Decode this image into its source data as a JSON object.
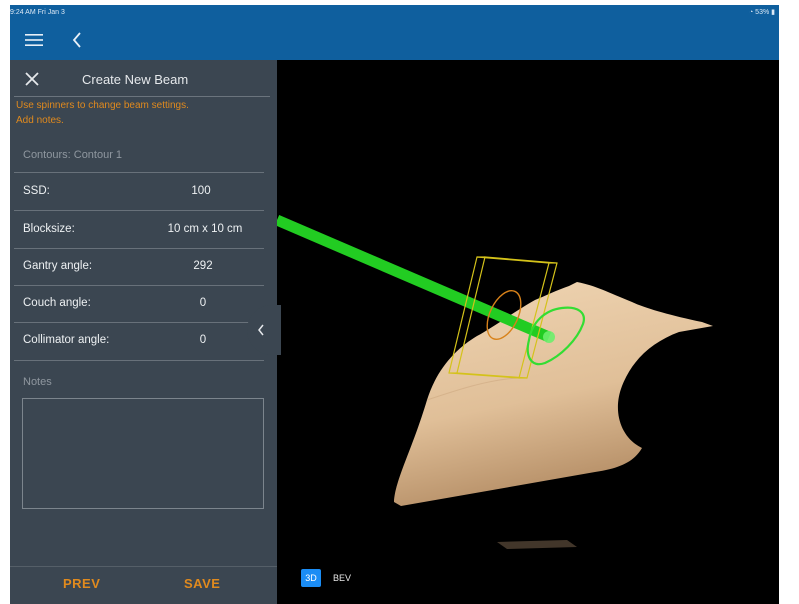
{
  "status_bar": {
    "time": "9:24 AM  Fri Jan 3",
    "battery": "53%"
  },
  "navbar": {
    "menu_icon": "hamburger-icon",
    "back_icon": "chevron-left-icon",
    "color": "#0f5f9e"
  },
  "panel": {
    "title": "Create New Beam",
    "instructions_line1": "Use spinners to change beam settings.",
    "instructions_line2": "Add notes.",
    "contours": "Contours: Contour 1",
    "fields": [
      {
        "label": "SSD:",
        "value": "100"
      },
      {
        "label": "Blocksize:",
        "value": "10 cm x 10 cm"
      },
      {
        "label": "Gantry angle:",
        "value": "292"
      },
      {
        "label": "Couch angle:",
        "value": "0"
      },
      {
        "label": "Collimator angle:",
        "value": "0"
      }
    ],
    "notes_label": "Notes",
    "notes_value": "",
    "prev_label": "PREV",
    "save_label": "SAVE",
    "accent_color": "#e08a1e",
    "background": "#3b4651"
  },
  "viewport": {
    "mode_3d_label": "3D",
    "mode_bev_label": "BEV",
    "active_mode": "3D",
    "beam_color": "#22cc22",
    "contour_color": "#33dd33",
    "block_outline_color": "#d4c21a",
    "skin_color": "#e3c4a0"
  }
}
